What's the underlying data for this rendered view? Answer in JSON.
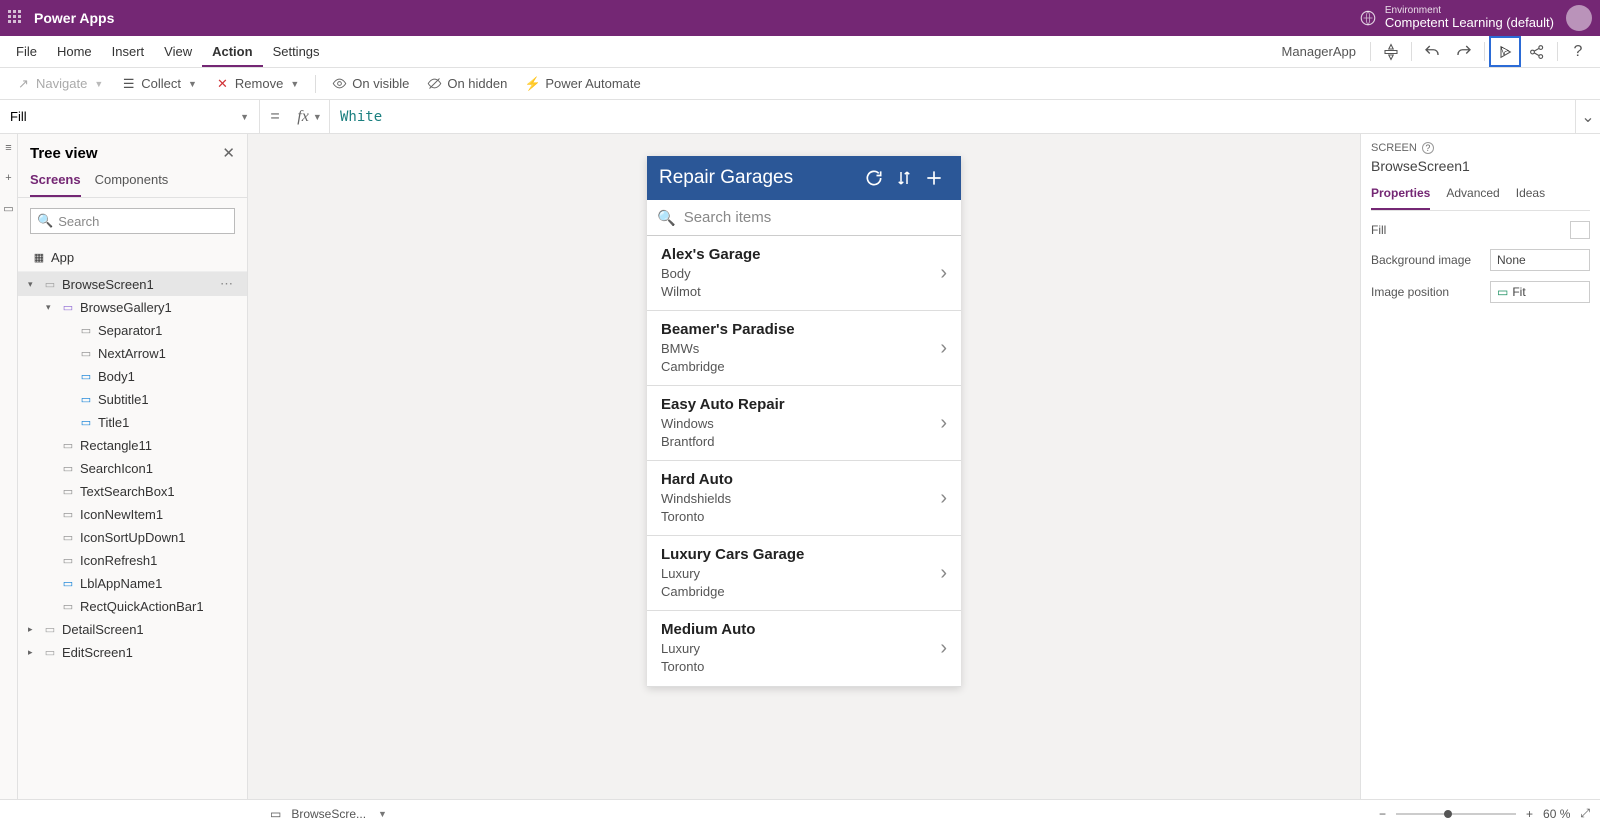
{
  "header": {
    "product": "Power Apps",
    "env_label": "Environment",
    "env_name": "Competent Learning (default)"
  },
  "menu": {
    "items": [
      "File",
      "Home",
      "Insert",
      "View",
      "Action",
      "Settings"
    ],
    "active": "Action",
    "app_name": "ManagerApp"
  },
  "action_bar": {
    "navigate": "Navigate",
    "collect": "Collect",
    "remove": "Remove",
    "on_visible": "On visible",
    "on_hidden": "On hidden",
    "power_automate": "Power Automate"
  },
  "formula": {
    "property": "Fill",
    "value": "White"
  },
  "tree": {
    "title": "Tree view",
    "tabs": [
      "Screens",
      "Components"
    ],
    "active_tab": "Screens",
    "search_placeholder": "Search",
    "app_node": "App",
    "selected": "BrowseScreen1",
    "nodes": [
      {
        "name": "BrowseScreen1",
        "depth": 0,
        "expandable": true,
        "expanded": true,
        "selected": true,
        "iconColor": "#999"
      },
      {
        "name": "BrowseGallery1",
        "depth": 1,
        "expandable": true,
        "expanded": true,
        "iconColor": "#8a63d2"
      },
      {
        "name": "Separator1",
        "depth": 2,
        "iconColor": "#888"
      },
      {
        "name": "NextArrow1",
        "depth": 2,
        "iconColor": "#888"
      },
      {
        "name": "Body1",
        "depth": 2,
        "iconColor": "#0078d4"
      },
      {
        "name": "Subtitle1",
        "depth": 2,
        "iconColor": "#0078d4"
      },
      {
        "name": "Title1",
        "depth": 2,
        "iconColor": "#0078d4"
      },
      {
        "name": "Rectangle11",
        "depth": 1,
        "iconColor": "#888"
      },
      {
        "name": "SearchIcon1",
        "depth": 1,
        "iconColor": "#888"
      },
      {
        "name": "TextSearchBox1",
        "depth": 1,
        "iconColor": "#888"
      },
      {
        "name": "IconNewItem1",
        "depth": 1,
        "iconColor": "#888"
      },
      {
        "name": "IconSortUpDown1",
        "depth": 1,
        "iconColor": "#888"
      },
      {
        "name": "IconRefresh1",
        "depth": 1,
        "iconColor": "#888"
      },
      {
        "name": "LblAppName1",
        "depth": 1,
        "iconColor": "#0078d4"
      },
      {
        "name": "RectQuickActionBar1",
        "depth": 1,
        "iconColor": "#888"
      }
    ],
    "collapsed_nodes": [
      "DetailScreen1",
      "EditScreen1"
    ]
  },
  "app_canvas": {
    "title": "Repair Garages",
    "search_placeholder": "Search items",
    "items": [
      {
        "title": "Alex's Garage",
        "sub1": "Body",
        "sub2": "Wilmot"
      },
      {
        "title": "Beamer's Paradise",
        "sub1": "BMWs",
        "sub2": "Cambridge"
      },
      {
        "title": "Easy Auto Repair",
        "sub1": "Windows",
        "sub2": "Brantford"
      },
      {
        "title": "Hard Auto",
        "sub1": "Windshields",
        "sub2": "Toronto"
      },
      {
        "title": "Luxury Cars Garage",
        "sub1": "Luxury",
        "sub2": "Cambridge"
      },
      {
        "title": "Medium Auto",
        "sub1": "Luxury",
        "sub2": "Toronto"
      }
    ]
  },
  "props": {
    "section": "SCREEN",
    "screen_name": "BrowseScreen1",
    "tabs": [
      "Properties",
      "Advanced",
      "Ideas"
    ],
    "active_tab": "Properties",
    "fill_label": "Fill",
    "bg_image_label": "Background image",
    "bg_image_value": "None",
    "img_pos_label": "Image position",
    "img_pos_value": "Fit"
  },
  "status": {
    "breadcrumb": "BrowseScre...",
    "zoom": "60 %"
  }
}
